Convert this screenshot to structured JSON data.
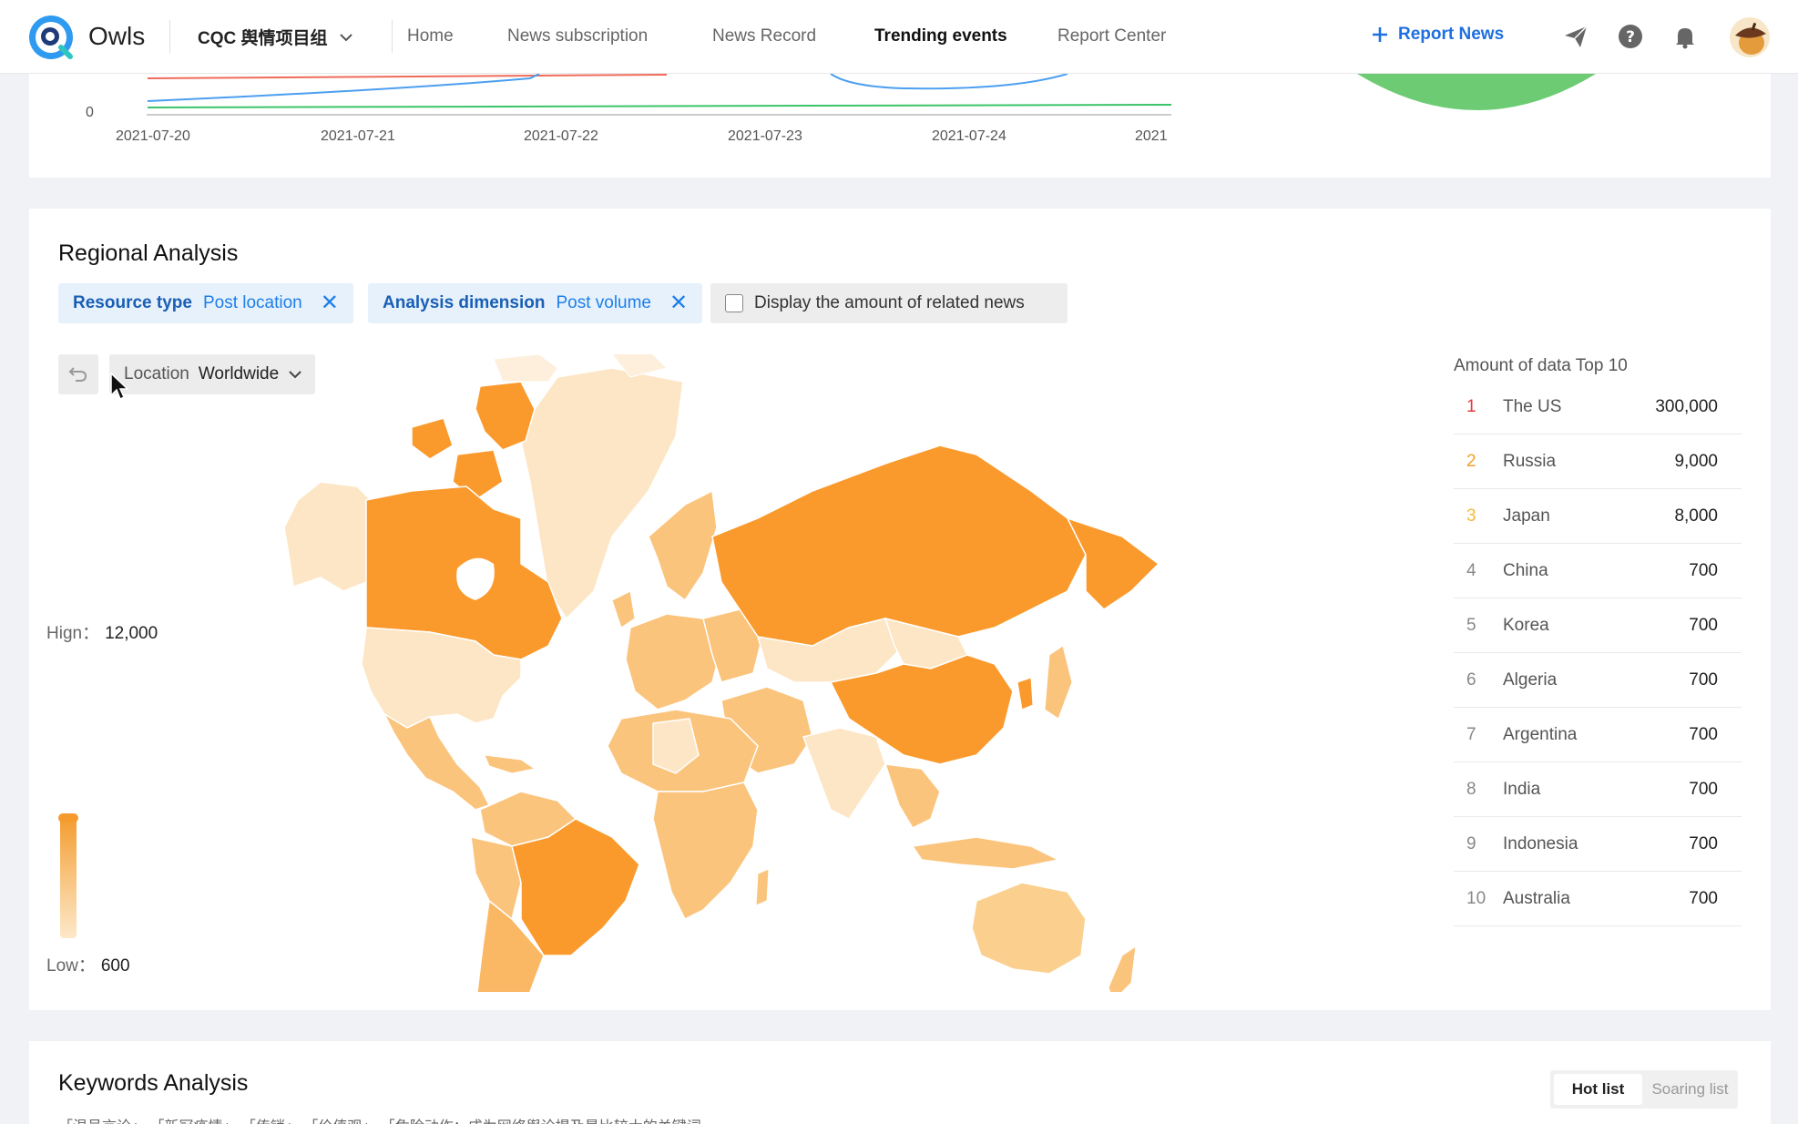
{
  "header": {
    "brand": "Owls",
    "team": "CQC 舆情项目组",
    "nav": [
      "Home",
      "News subscription",
      "News Record",
      "Trending events",
      "Report Center"
    ],
    "active_nav": "Trending events",
    "report_button": "Report News",
    "icons": [
      "send-icon",
      "help-icon",
      "bell-icon",
      "avatar"
    ]
  },
  "trend_chart": {
    "y_zero": "0",
    "dates": [
      "2021-07-20",
      "2021-07-21",
      "2021-07-22",
      "2021-07-23",
      "2021-07-24",
      "2021"
    ]
  },
  "regional": {
    "title": "Regional Analysis",
    "filters": [
      {
        "key": "Resource type",
        "value": "Post location"
      },
      {
        "key": "Analysis dimension",
        "value": "Post volume"
      }
    ],
    "checkbox_label": "Display the amount of related news",
    "checkbox_checked": false,
    "location_label": "Location",
    "location_value": "Worldwide",
    "legend": {
      "high_label": "Hign：",
      "high_value": "12,000",
      "low_label": "Low：",
      "low_value": "600"
    },
    "top10_title": "Amount of data Top 10",
    "top10": [
      {
        "rank": "1",
        "country": "The US",
        "amount": "300,000"
      },
      {
        "rank": "2",
        "country": "Russia",
        "amount": "9,000"
      },
      {
        "rank": "3",
        "country": "Japan",
        "amount": "8,000"
      },
      {
        "rank": "4",
        "country": "China",
        "amount": "700"
      },
      {
        "rank": "5",
        "country": "Korea",
        "amount": "700"
      },
      {
        "rank": "6",
        "country": "Algeria",
        "amount": "700"
      },
      {
        "rank": "7",
        "country": "Argentina",
        "amount": "700"
      },
      {
        "rank": "8",
        "country": "India",
        "amount": "700"
      },
      {
        "rank": "9",
        "country": "Indonesia",
        "amount": "700"
      },
      {
        "rank": "10",
        "country": "Australia",
        "amount": "700"
      }
    ],
    "rank_colors": {
      "1": "#e8373a",
      "2": "#f0a028",
      "3": "#f5b93a"
    },
    "map_colors": {
      "dark": "#fa9a2d",
      "mid": "#fbc47c",
      "light": "#fde6c5"
    }
  },
  "keywords": {
    "title": "Keywords Analysis",
    "tabs": [
      "Hot list",
      "Soaring list"
    ],
    "active_tab": "Hot list",
    "tags_preview": "「温号言论」 「新冠疫情」 「传销」 「价值观」 「危险动作：成为网络舆论提及最比较大的关键词"
  }
}
